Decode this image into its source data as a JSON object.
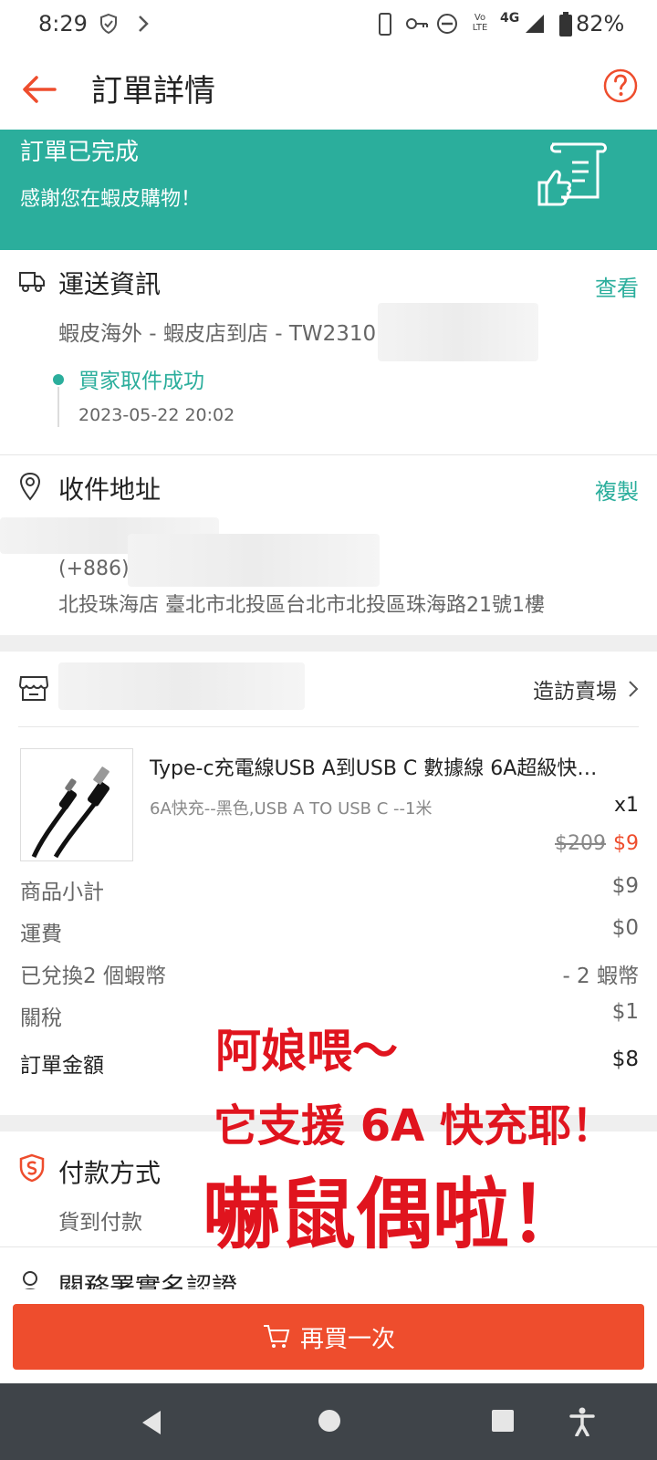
{
  "status_bar": {
    "time": "8:29",
    "network": "4G",
    "volte": "Vo LTE",
    "battery": "82%"
  },
  "header": {
    "title": "訂單詳情"
  },
  "banner": {
    "title": "訂單已完成",
    "subtitle": "感謝您在蝦皮購物！"
  },
  "shipping": {
    "title": "運送資訊",
    "action": "查看",
    "method": "蝦皮海外 - 蝦皮店到店 - TW2310",
    "status": "買家取件成功",
    "timestamp": "2023-05-22 20:02"
  },
  "address": {
    "title": "收件地址",
    "action": "複製",
    "phone": "(+886)",
    "detail": "北投珠海店 臺北市北投區台北市北投區珠海路21號1樓"
  },
  "shop": {
    "visit_label": "造訪賣場"
  },
  "product": {
    "name": "Type-c充電線USB A到USB C 數據線 6A超級快…",
    "variant": "6A快充--黑色,USB A TO USB C --1米",
    "quantity": "x1",
    "original_price": "$209",
    "price": "$9"
  },
  "summary": {
    "rows": [
      {
        "label": "商品小計",
        "value": "$9"
      },
      {
        "label": "運費",
        "value": "$0"
      },
      {
        "label": "已兌換2 個蝦幣",
        "value": "- 2 蝦幣"
      },
      {
        "label": "關稅",
        "value": "$1"
      },
      {
        "label": "訂單金額",
        "value": "$8"
      }
    ]
  },
  "payment": {
    "title": "付款方式",
    "method": "貨到付款"
  },
  "customs": {
    "title": "關務署實名認證"
  },
  "overlay": {
    "line1": "阿娘喂～",
    "line2": "它支援 6A 快充耶！",
    "line3": "嚇鼠偶啦！"
  },
  "actions": {
    "buy_again": "再買一次"
  },
  "colors": {
    "accent": "#ee4d2d",
    "teal": "#2bae9c"
  }
}
